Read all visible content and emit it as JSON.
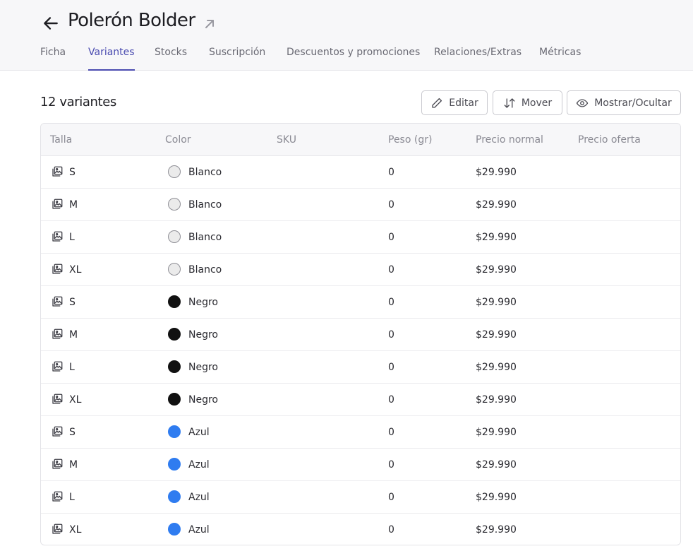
{
  "product": {
    "title": "Polerón Bolder"
  },
  "tabs": [
    {
      "label": "Ficha"
    },
    {
      "label": "Variantes",
      "active": true
    },
    {
      "label": "Stocks"
    },
    {
      "label": "Suscripción"
    },
    {
      "label": "Descuentos y promociones"
    },
    {
      "label": "Relaciones/Extras"
    },
    {
      "label": "Métricas"
    }
  ],
  "summary": {
    "count_label": "12 variantes"
  },
  "actions": {
    "edit": "Editar",
    "move": "Mover",
    "toggle": "Mostrar/Ocultar"
  },
  "table": {
    "headers": [
      "Talla",
      "Color",
      "SKU",
      "Peso (gr)",
      "Precio normal",
      "Precio oferta"
    ],
    "rows": [
      {
        "size": "S",
        "color": "Blanco",
        "swatch": "#ebebeb",
        "sku": "",
        "weight": "0",
        "price": "$29.990",
        "offer": ""
      },
      {
        "size": "M",
        "color": "Blanco",
        "swatch": "#ebebeb",
        "sku": "",
        "weight": "0",
        "price": "$29.990",
        "offer": ""
      },
      {
        "size": "L",
        "color": "Blanco",
        "swatch": "#ebebeb",
        "sku": "",
        "weight": "0",
        "price": "$29.990",
        "offer": ""
      },
      {
        "size": "XL",
        "color": "Blanco",
        "swatch": "#ebebeb",
        "sku": "",
        "weight": "0",
        "price": "$29.990",
        "offer": ""
      },
      {
        "size": "S",
        "color": "Negro",
        "swatch": "#111111",
        "sku": "",
        "weight": "0",
        "price": "$29.990",
        "offer": ""
      },
      {
        "size": "M",
        "color": "Negro",
        "swatch": "#111111",
        "sku": "",
        "weight": "0",
        "price": "$29.990",
        "offer": ""
      },
      {
        "size": "L",
        "color": "Negro",
        "swatch": "#111111",
        "sku": "",
        "weight": "0",
        "price": "$29.990",
        "offer": ""
      },
      {
        "size": "XL",
        "color": "Negro",
        "swatch": "#111111",
        "sku": "",
        "weight": "0",
        "price": "$29.990",
        "offer": ""
      },
      {
        "size": "S",
        "color": "Azul",
        "swatch": "#2f7cf0",
        "sku": "",
        "weight": "0",
        "price": "$29.990",
        "offer": ""
      },
      {
        "size": "M",
        "color": "Azul",
        "swatch": "#2f7cf0",
        "sku": "",
        "weight": "0",
        "price": "$29.990",
        "offer": ""
      },
      {
        "size": "L",
        "color": "Azul",
        "swatch": "#2f7cf0",
        "sku": "",
        "weight": "0",
        "price": "$29.990",
        "offer": ""
      },
      {
        "size": "XL",
        "color": "Azul",
        "swatch": "#2f7cf0",
        "sku": "",
        "weight": "0",
        "price": "$29.990",
        "offer": ""
      }
    ]
  },
  "theme": {
    "accent": "#4a4bb0",
    "border": "#c9c9cf"
  }
}
